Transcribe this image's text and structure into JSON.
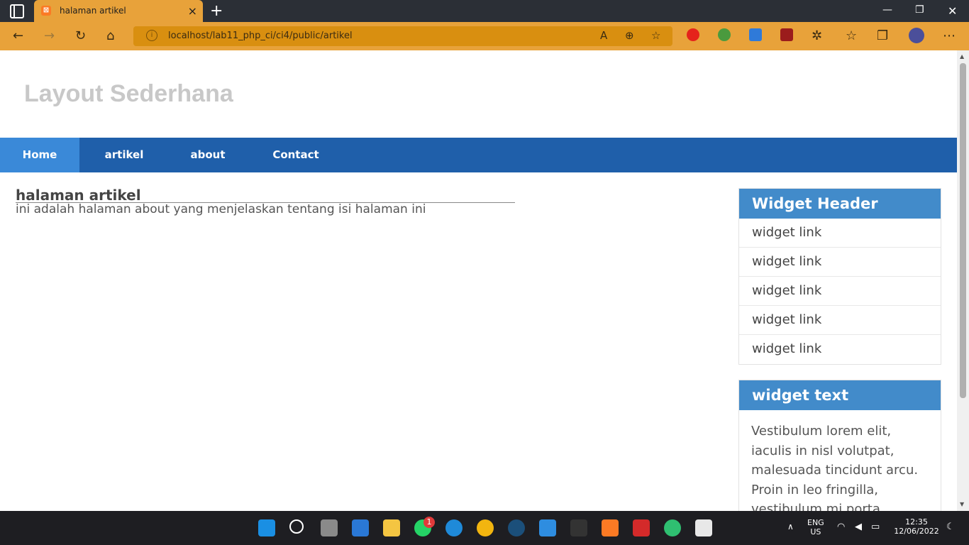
{
  "browser": {
    "tab_title": "halaman artikel",
    "url": "localhost/lab11_php_ci/ci4/public/artikel",
    "favicon_letter": "⊠"
  },
  "site": {
    "title": "Layout Sederhana",
    "nav": [
      "Home",
      "artikel",
      "about",
      "Contact"
    ]
  },
  "content": {
    "title": "halaman artikel",
    "text": "ini adalah halaman about yang menjelaskan tentang isi halaman ini"
  },
  "sidebar": {
    "widget1_header": "Widget Header",
    "links": [
      "widget link",
      "widget link",
      "widget link",
      "widget link",
      "widget link"
    ],
    "widget2_header": "widget text",
    "widget2_body": "Vestibulum lorem elit, iaculis in nisl volutpat, malesuada tincidunt arcu. Proin in leo fringilla, vestibulum mi porta, faucibus felis. Integer"
  },
  "taskbar": {
    "lang": "ENG",
    "region": "US",
    "time": "12:35",
    "date": "12/06/2022",
    "whatsapp_badge": "1"
  },
  "colors": {
    "nav_bg": "#1f5faa",
    "nav_active": "#3a89d8",
    "widget_header": "#428bca",
    "browser_accent": "#e8a23a"
  }
}
